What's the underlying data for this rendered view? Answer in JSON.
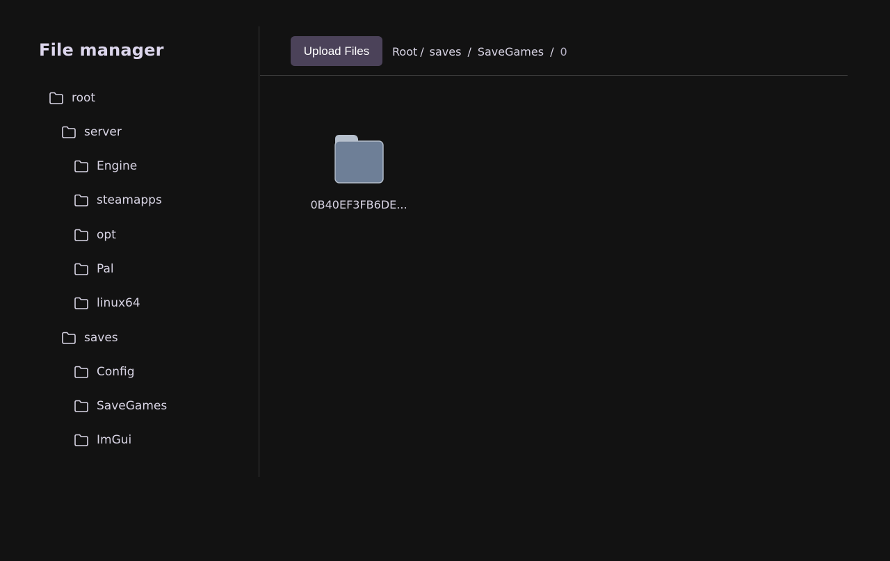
{
  "sidebar": {
    "title": "File manager",
    "items": [
      {
        "label": "root",
        "depth": 0,
        "icon": "folder-icon"
      },
      {
        "label": "server",
        "depth": 1,
        "icon": "folder-icon"
      },
      {
        "label": "Engine",
        "depth": 2,
        "icon": "folder-icon"
      },
      {
        "label": "steamapps",
        "depth": 2,
        "icon": "folder-icon"
      },
      {
        "label": "opt",
        "depth": 2,
        "icon": "folder-icon"
      },
      {
        "label": "Pal",
        "depth": 2,
        "icon": "folder-icon"
      },
      {
        "label": "linux64",
        "depth": 2,
        "icon": "folder-icon"
      },
      {
        "label": "saves",
        "depth": 1,
        "icon": "folder-icon"
      },
      {
        "label": "Config",
        "depth": 2,
        "icon": "folder-icon"
      },
      {
        "label": "SaveGames",
        "depth": 2,
        "icon": "folder-icon"
      },
      {
        "label": "ImGui",
        "depth": 2,
        "icon": "folder-icon"
      }
    ]
  },
  "toolbar": {
    "upload_label": "Upload Files"
  },
  "breadcrumb": {
    "items": [
      "Root",
      "saves",
      "SaveGames",
      "0"
    ],
    "separator": "/"
  },
  "files": [
    {
      "name": "0B40EF3FB6DE...",
      "type": "folder",
      "icon": "folder-icon"
    }
  ],
  "colors": {
    "background": "#121212",
    "accent_button": "#4b4259",
    "folder_fill": "#6e7f97",
    "folder_tab": "#b5bfcc",
    "divider": "#3a3a3a"
  }
}
